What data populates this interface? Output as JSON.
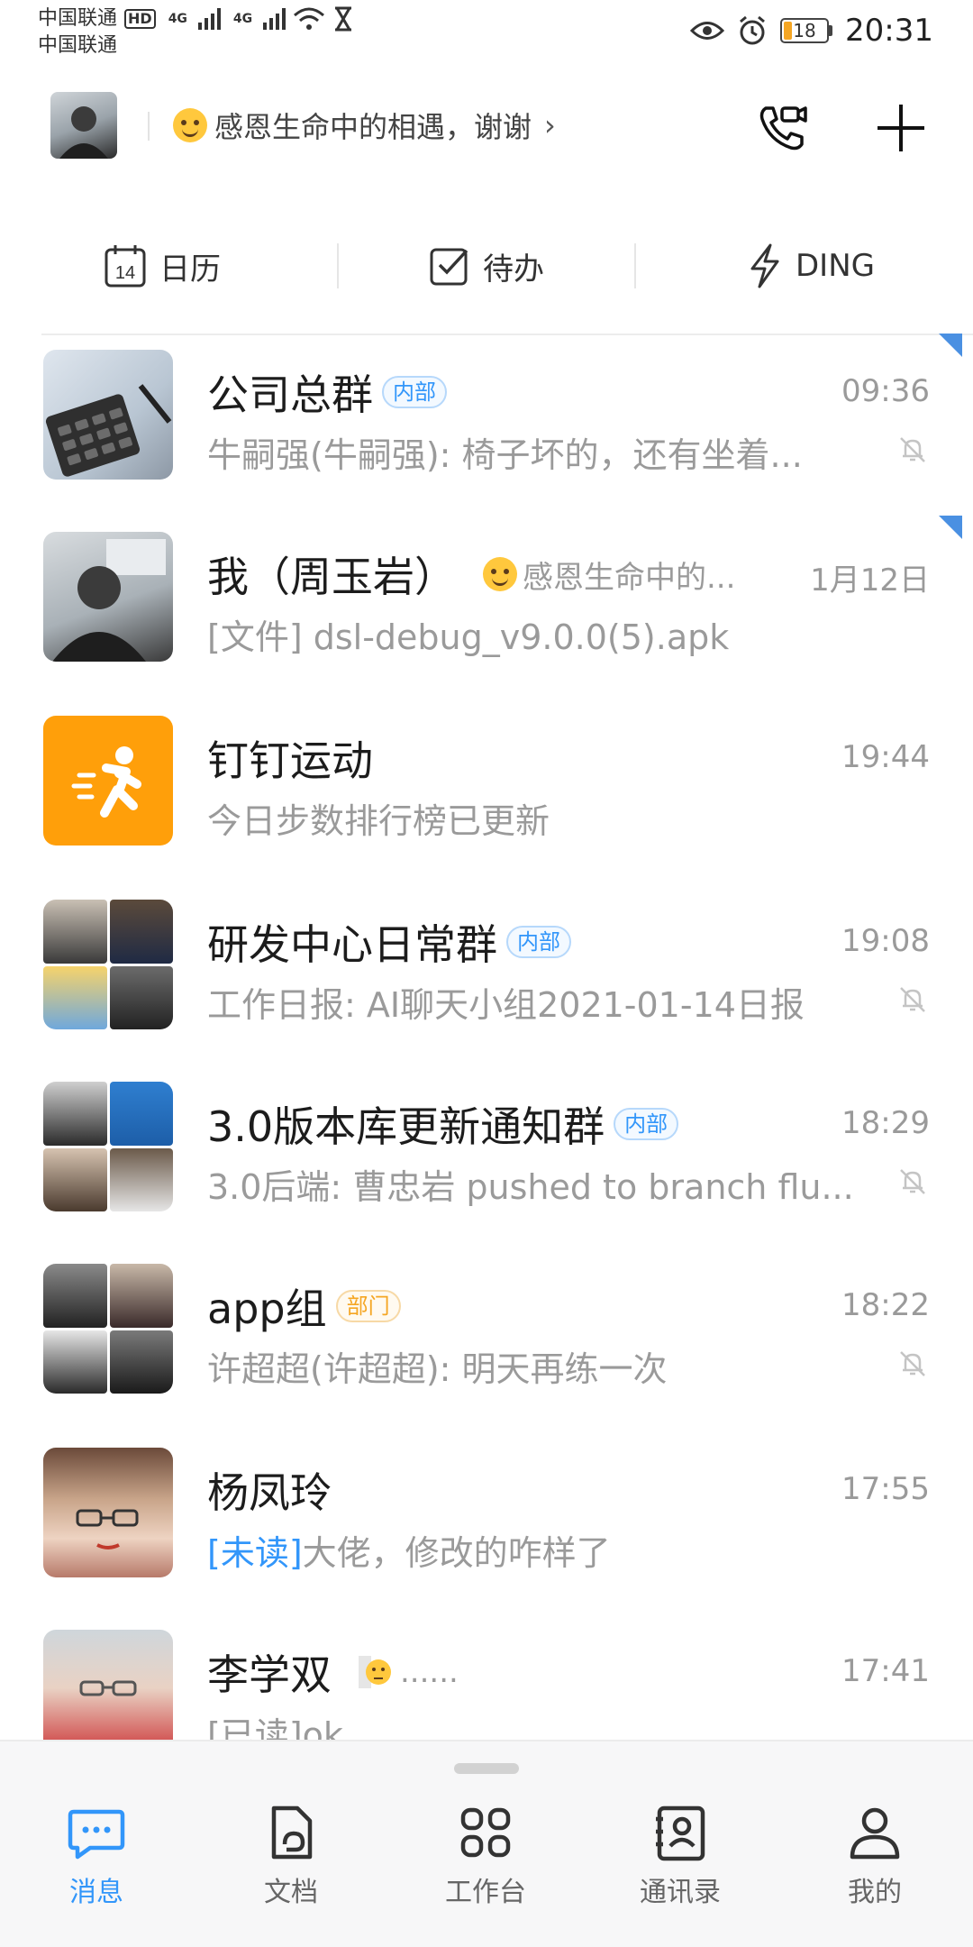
{
  "status_bar": {
    "carrier1": "中国联通",
    "carrier2": "中国联通",
    "hd": "HD",
    "net1": "4G",
    "net2": "4G",
    "battery": "18",
    "battery_level": 0.18,
    "time": "20:31"
  },
  "header": {
    "status_message": "感恩生命中的相遇，谢谢"
  },
  "quick_tabs": [
    {
      "label": "日历",
      "icon": "calendar-icon",
      "day": "14"
    },
    {
      "label": "待办",
      "icon": "checkbox-icon"
    },
    {
      "label": "DING",
      "icon": "lightning-icon"
    }
  ],
  "conversations": [
    {
      "name": "公司总群",
      "tag": "内部",
      "time": "09:36",
      "preview": "牛嗣强(牛嗣强): 椅子坏的，还有坐着...",
      "muted": true,
      "pinned": true
    },
    {
      "name": "我（周玉岩）",
      "status": "感恩生命中的...",
      "time": "1月12日",
      "preview": "[文件] dsl-debug_v9.0.0(5).apk",
      "pinned": true
    },
    {
      "name": "钉钉运动",
      "time": "19:44",
      "preview": "今日步数排行榜已更新"
    },
    {
      "name": "研发中心日常群",
      "tag": "内部",
      "time": "19:08",
      "preview": "工作日报: AI聊天小组2021-01-14日报",
      "muted": true
    },
    {
      "name": "3.0版本库更新通知群",
      "tag": "内部",
      "time": "18:29",
      "preview": "3.0后端: 曹忠岩 pushed to branch flu...",
      "muted": true
    },
    {
      "name": "app组",
      "tag": "部门",
      "time": "18:22",
      "preview": "许超超(许超超): 明天再练一次",
      "muted": true
    },
    {
      "name": "杨凤玲",
      "time": "17:55",
      "unread": "[未读]",
      "preview": "大佬，修改的咋样了"
    },
    {
      "name": "李学双",
      "status": "......",
      "time": "17:41",
      "preview": "[已读]ok"
    }
  ],
  "bottom_nav": [
    {
      "label": "消息",
      "icon": "message-icon",
      "active": true
    },
    {
      "label": "文档",
      "icon": "document-icon"
    },
    {
      "label": "工作台",
      "icon": "workbench-icon"
    },
    {
      "label": "通讯录",
      "icon": "contacts-icon"
    },
    {
      "label": "我的",
      "icon": "profile-icon"
    }
  ],
  "colors": {
    "accent": "#3296fa",
    "sport_orange": "#ff9f0a",
    "tag_blue": "#3296fa",
    "tag_orange": "#f5a623"
  }
}
